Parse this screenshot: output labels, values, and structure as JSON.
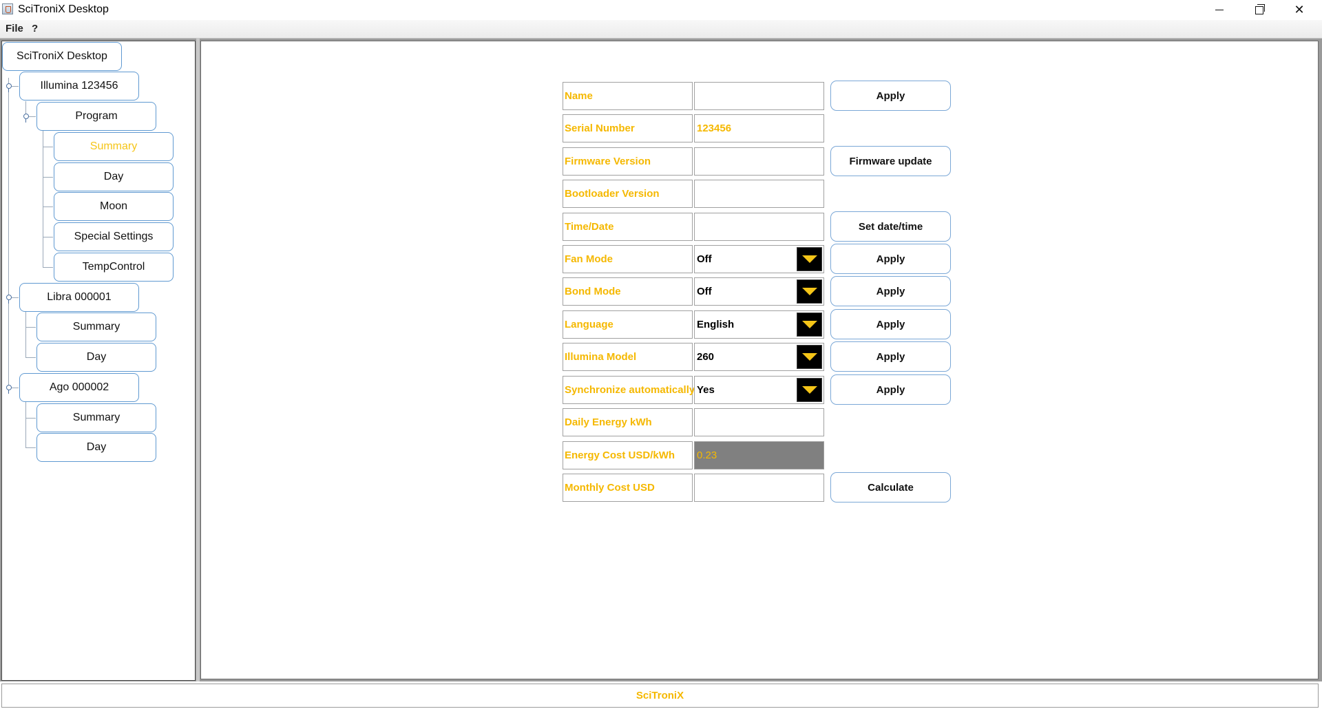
{
  "window": {
    "title": "SciTroniX Desktop"
  },
  "menu": {
    "file": "File",
    "help": "?"
  },
  "tree": {
    "root": "SciTroniX Desktop",
    "devices": [
      {
        "label": "Illumina 123456"
      },
      {
        "label": "Libra 000001"
      },
      {
        "label": "Ago 000002"
      }
    ],
    "program": "Program",
    "program_items": [
      "Summary",
      "Day",
      "Moon",
      "Special Settings",
      "TempControl"
    ],
    "libra_items": [
      "Summary",
      "Day"
    ],
    "ago_items": [
      "Summary",
      "Day"
    ],
    "selected": "Illumina 123456 / Program / Summary"
  },
  "form": {
    "name": {
      "label": "Name",
      "value": "",
      "button": "Apply"
    },
    "serial": {
      "label": "Serial Number",
      "value": "123456"
    },
    "firmware": {
      "label": "Firmware Version",
      "value": "",
      "button": "Firmware update"
    },
    "bootloader": {
      "label": "Bootloader Version",
      "value": ""
    },
    "timedate": {
      "label": "Time/Date",
      "value": "",
      "button": "Set date/time"
    },
    "fan_mode": {
      "label": "Fan Mode",
      "value": "Off",
      "button": "Apply"
    },
    "bond_mode": {
      "label": "Bond Mode",
      "value": "Off",
      "button": "Apply"
    },
    "language": {
      "label": "Language",
      "value": "English",
      "button": "Apply"
    },
    "model": {
      "label": "Illumina Model",
      "value": "260",
      "button": "Apply"
    },
    "sync": {
      "label": "Synchronize automatically",
      "value": "Yes",
      "button": "Apply"
    },
    "daily_energy": {
      "label": "Daily Energy kWh",
      "value": ""
    },
    "energy_cost": {
      "label": "Energy Cost USD/kWh",
      "value": "0.23"
    },
    "monthly_cost": {
      "label": "Monthly Cost USD",
      "value": "",
      "button": "Calculate"
    }
  },
  "status": {
    "text": "SciTroniX"
  },
  "colors": {
    "accent": "#f5b800",
    "selected": "#f5c518",
    "node_border": "#5f99d1",
    "disabled_field": "#808080"
  },
  "icons": {
    "minimize": "minimize-icon",
    "restore": "restore-icon",
    "close": "close-icon",
    "dropdown": "chevron-down-icon"
  }
}
